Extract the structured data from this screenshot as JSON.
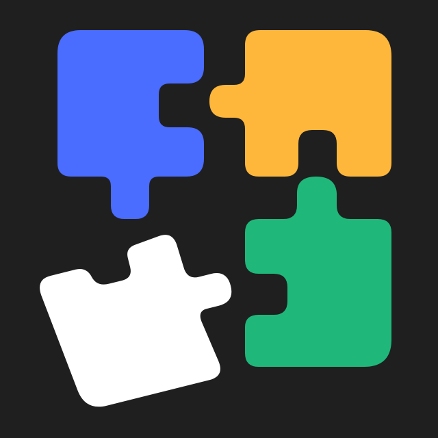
{
  "icon": {
    "name": "puzzle-pieces-icon",
    "colors": {
      "background": "#1f1f1f",
      "blue_piece": "#4a6cff",
      "yellow_piece": "#ffb73b",
      "green_piece": "#1fb87a",
      "white_piece": "#ffffff"
    }
  }
}
